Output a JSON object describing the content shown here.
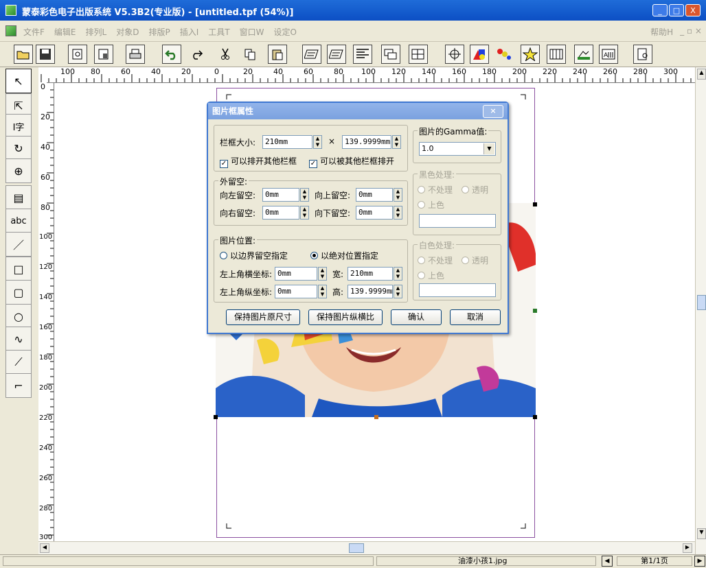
{
  "window": {
    "title": "蒙泰彩色电子出版系统 V5.3B2(专业版) - [untitled.tpf (54%)]",
    "buttons": {
      "minimize": "_",
      "maximize": "□",
      "close": "X"
    }
  },
  "menubar": {
    "items": [
      "文件F",
      "编辑E",
      "排列L",
      "对象D",
      "排版P",
      "插入I",
      "工具T",
      "窗口W",
      "设定O"
    ],
    "help": "帮助H",
    "restore_controls": "_ ▫ ×"
  },
  "toolbar": {
    "icons": [
      "open-icon",
      "save-icon",
      "page-setup-icon",
      "import-icon",
      "print-icon",
      "undo-icon",
      "redo-icon",
      "cut-icon",
      "copy-icon",
      "paste-icon",
      "text-flow-icon",
      "text-frame-icon",
      "align-icon",
      "layers-icon",
      "group-icon",
      "crosshair-icon",
      "color-shapes-icon",
      "paint-icon",
      "star-icon",
      "map-icon",
      "picture-icon",
      "text-box-icon",
      "zoom-page-icon"
    ]
  },
  "left_tools": {
    "labels": [
      "↖",
      "⇱",
      "I字",
      "↻",
      "⊕",
      "▤",
      "abc",
      "／",
      "□",
      "▢",
      "○",
      "∿",
      "⟋",
      "⌐"
    ]
  },
  "rulers": {
    "horizontal": [
      "100",
      "80",
      "60",
      "40",
      "20",
      "0",
      "20",
      "40",
      "60",
      "80",
      "100",
      "120",
      "140",
      "160",
      "180",
      "200",
      "220",
      "240",
      "260",
      "280",
      "300"
    ],
    "vertical": [
      "0",
      "20",
      "40",
      "60",
      "80",
      "100",
      "120",
      "140",
      "160",
      "180",
      "200",
      "220",
      "240",
      "260",
      "280",
      "300"
    ]
  },
  "dialog": {
    "title": "图片框属性",
    "close": "×",
    "frame_size_label": "栏框大小:",
    "frame_width": "210mm",
    "times": "×",
    "frame_height": "139.9999mm",
    "check_push_others": "可以排开其他栏框",
    "check_pushed_by_others": "可以被其他栏框排开",
    "outer_margin_title": "外留空:",
    "left_margin_label": "向左留空:",
    "left_margin": "0mm",
    "top_margin_label": "向上留空:",
    "top_margin": "0mm",
    "right_margin_label": "向右留空:",
    "right_margin": "0mm",
    "bottom_margin_label": "向下留空:",
    "bottom_margin": "0mm",
    "position_title": "图片位置:",
    "radio_margin": "以边界留空指定",
    "radio_absolute": "以绝对位置指定",
    "x_label": "左上角横坐标:",
    "x_value": "0mm",
    "width_label": "宽:",
    "width_value": "210mm",
    "y_label": "左上角纵坐标:",
    "y_value": "0mm",
    "height_label": "高:",
    "height_value": "139.9999mm",
    "gamma_title": "图片的Gamma值:",
    "gamma_value": "1.0",
    "black_title": "黑色处理:",
    "white_title": "白色处理:",
    "opt_none": "不处理",
    "opt_transparent": "透明",
    "opt_color": "上色",
    "btn_keep_size": "保持图片原尺寸",
    "btn_keep_ratio": "保持图片纵横比",
    "btn_ok": "确认",
    "btn_cancel": "取消"
  },
  "status": {
    "filename": "油漆小孩1.jpg",
    "page": "第1/1页"
  },
  "colors": {
    "title_bar": "#0c4fc4",
    "page_border": "#8a4fa0",
    "dialog_border": "#3f78d2"
  }
}
